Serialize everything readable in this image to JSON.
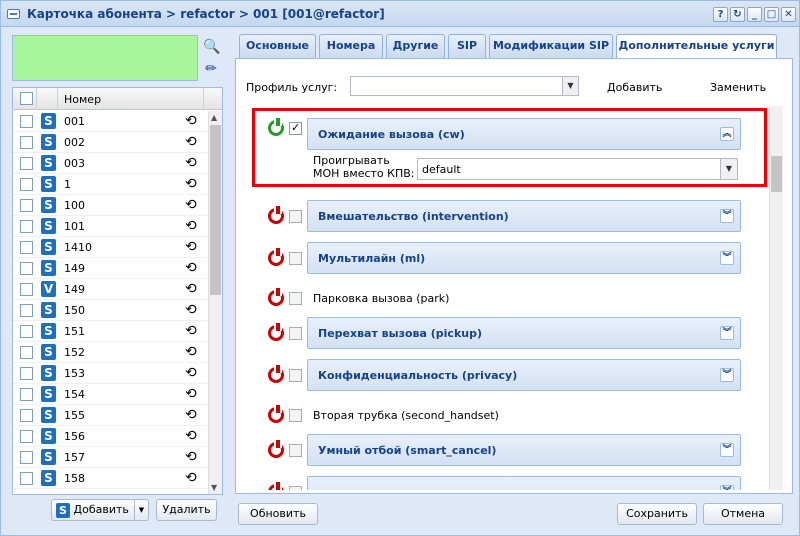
{
  "window": {
    "title": "Карточка абонента > refactor > 001 [001@refactor]",
    "buttons": [
      "?",
      "↻",
      "_",
      "□",
      "✕"
    ]
  },
  "left": {
    "header_number": "Номер",
    "rows": [
      {
        "type": "S",
        "number": "001"
      },
      {
        "type": "S",
        "number": "002"
      },
      {
        "type": "S",
        "number": "003"
      },
      {
        "type": "S",
        "number": "1"
      },
      {
        "type": "S",
        "number": "100"
      },
      {
        "type": "S",
        "number": "101"
      },
      {
        "type": "S",
        "number": "1410"
      },
      {
        "type": "S",
        "number": "149"
      },
      {
        "type": "V",
        "number": "149"
      },
      {
        "type": "S",
        "number": "150"
      },
      {
        "type": "S",
        "number": "151"
      },
      {
        "type": "S",
        "number": "152"
      },
      {
        "type": "S",
        "number": "153"
      },
      {
        "type": "S",
        "number": "154"
      },
      {
        "type": "S",
        "number": "155"
      },
      {
        "type": "S",
        "number": "156"
      },
      {
        "type": "S",
        "number": "157"
      },
      {
        "type": "S",
        "number": "158"
      }
    ],
    "add_label": "Добавить",
    "delete_label": "Удалить"
  },
  "tabs": [
    "Основные",
    "Номера",
    "Другие",
    "SIP",
    "Модификации SIP",
    "Дополнительные услуги"
  ],
  "active_tab": "Дополнительные услуги",
  "profile": {
    "label": "Профиль услуг:",
    "value": "",
    "add_label": "Добавить",
    "replace_label": "Заменить"
  },
  "services": [
    {
      "label": "Ожидание вызова (cw)",
      "enabled": true,
      "checked": true,
      "expandable": true,
      "expanded": true
    },
    {
      "label": "Вмешательство (intervention)",
      "enabled": false,
      "checked": false,
      "expandable": true,
      "expanded": false
    },
    {
      "label": "Мультилайн (ml)",
      "enabled": false,
      "checked": false,
      "expandable": true,
      "expanded": false
    },
    {
      "label": "Парковка вызова (park)",
      "enabled": false,
      "checked": false,
      "expandable": false,
      "expanded": false
    },
    {
      "label": "Перехват вызова (pickup)",
      "enabled": false,
      "checked": false,
      "expandable": true,
      "expanded": false
    },
    {
      "label": "Конфиденциальность (privacy)",
      "enabled": false,
      "checked": false,
      "expandable": true,
      "expanded": false
    },
    {
      "label": "Вторая трубка (second_handset)",
      "enabled": false,
      "checked": false,
      "expandable": false,
      "expanded": false
    },
    {
      "label": "Умный отбой (smart_cancel)",
      "enabled": false,
      "checked": false,
      "expandable": true,
      "expanded": false
    }
  ],
  "moh": {
    "label_line1": "Проигрывать",
    "label_line2": "MOH вместо КПВ:",
    "value": "default"
  },
  "footer": {
    "refresh_label": "Обновить",
    "save_label": "Сохранить",
    "cancel_label": "Отмена"
  },
  "colors": {
    "accent": "#15428b",
    "highlight_border": "#e00000",
    "preview_fill": "#a8f59b",
    "power_on": "#2a9a2a",
    "power_off": "#cc0000"
  }
}
